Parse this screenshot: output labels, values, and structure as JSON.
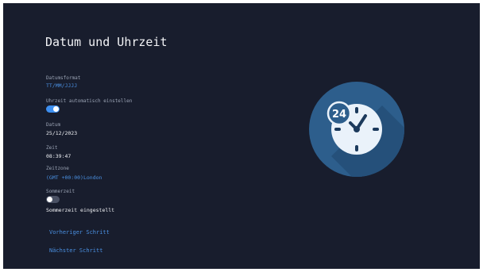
{
  "page": {
    "title": "Datum und Uhrzeit"
  },
  "settings": {
    "date_format": {
      "label": "Datumsformat",
      "value": "TT/MM/JJJJ"
    },
    "auto_time": {
      "label": "Uhrzeit automatisch einstellen",
      "enabled": true
    },
    "date": {
      "label": "Datum",
      "value": "25/12/2023"
    },
    "time": {
      "label": "Zeit",
      "value": "08:39:47"
    },
    "timezone": {
      "label": "Zeitzone",
      "value": "(GMT +00:00)London"
    },
    "dst": {
      "label": "Sommerzeit",
      "enabled": false,
      "status_text": "Sommerzeit eingestellt"
    }
  },
  "navigation": {
    "previous_label": "Vorheriger Schritt",
    "next_label": "Nächster Schritt"
  },
  "illustration": {
    "icon": "clock-24h-icon",
    "badge_text": "24"
  },
  "colors": {
    "background": "#181d2d",
    "accent": "#3d8ff0",
    "link": "#4a90e2",
    "illustration_circle": "#2d5e8c",
    "clock_face": "#eaf2fa",
    "clock_hands": "#1c3a5c"
  }
}
